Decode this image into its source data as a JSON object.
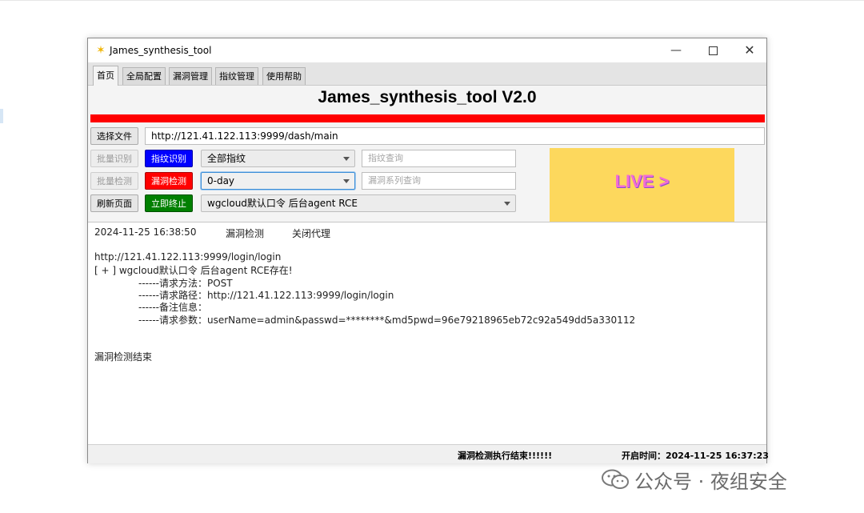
{
  "window": {
    "title": "James_synthesis_tool",
    "heading": "James_synthesis_tool V2.0"
  },
  "tabs": [
    {
      "label": "首页",
      "active": true
    },
    {
      "label": "全局配置"
    },
    {
      "label": "漏洞管理"
    },
    {
      "label": "指纹管理"
    },
    {
      "label": "使用帮助"
    }
  ],
  "controls": {
    "select_file_label": "选择文件",
    "url_value": "http://121.41.122.113:9999/dash/main",
    "batch_identify_label": "批量识别",
    "fingerprint_identify_label": "指纹识别",
    "fingerprint_combo_value": "全部指纹",
    "fingerprint_query_placeholder": "指纹查询",
    "batch_detect_label": "批量检测",
    "vuln_detect_label": "漏洞检测",
    "vuln_combo_value": "0-day",
    "vuln_series_query_placeholder": "漏洞系列查询",
    "refresh_label": "刷新页面",
    "stop_label": "立即终止",
    "poc_combo_value": "wgcloud默认口令 后台agent RCE"
  },
  "live_banner": {
    "text": "LIVE >",
    "bg_color": "#fdd85d",
    "text_color": "#f36bd5"
  },
  "output": {
    "timestamp": "2024-11-25 16:38:50",
    "mode": "漏洞检测",
    "proxy": "关闭代理",
    "target_url": "http://121.41.122.113:9999/login/login",
    "result": "[ + ] wgcloud默认口令 后台agent RCE存在!",
    "request_method": "------请求方法：POST",
    "request_path": "------请求路径：http://121.41.122.113:9999/login/login",
    "remark": "------备注信息：",
    "request_params": "------请求参数：userName=admin&passwd=********&md5pwd=96e79218965eb72c92a549dd5a330112",
    "end_message": "漏洞检测结束"
  },
  "status": {
    "message": "漏洞检测执行结束!!!!!!",
    "start_time": "开启时间：2024-11-25 16:37:23"
  },
  "watermark": {
    "text": "公众号 · 夜组安全"
  },
  "colors": {
    "red_bar": "#ff0000",
    "blue_button": "#0000ff",
    "red_button": "#ff0000",
    "green_button": "#008000"
  }
}
